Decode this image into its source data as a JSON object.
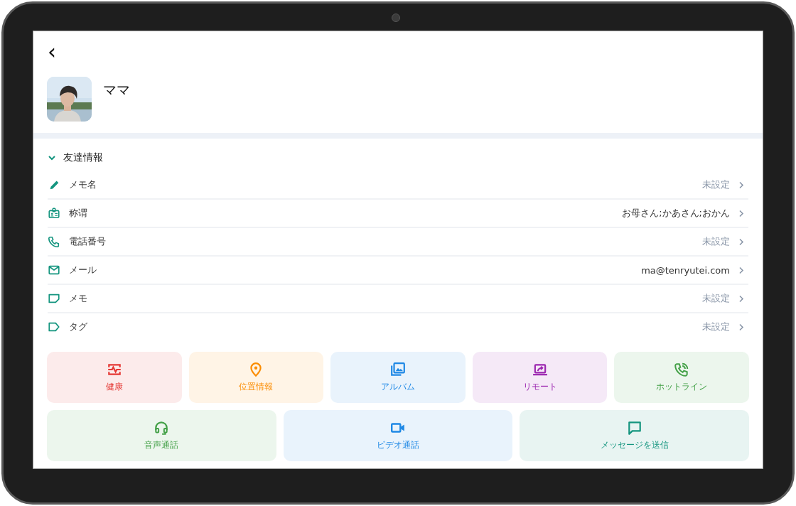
{
  "header": {
    "back": "‹",
    "name": "ママ"
  },
  "section": {
    "title": "友達情報",
    "expanded": true
  },
  "rows": [
    {
      "kind": "pencil",
      "label": "メモ名",
      "value": "未設定",
      "unset": true
    },
    {
      "kind": "badge",
      "label": "称谓",
      "value": "お母さん;かあさん;おかん",
      "unset": false
    },
    {
      "kind": "phone",
      "label": "電話番号",
      "value": "未設定",
      "unset": true
    },
    {
      "kind": "mail",
      "label": "メール",
      "value": "ma@tenryutei.com",
      "unset": false
    },
    {
      "kind": "note",
      "label": "メモ",
      "value": "未設定",
      "unset": true
    },
    {
      "kind": "tag",
      "label": "タグ",
      "value": "未設定",
      "unset": true
    }
  ],
  "actions": [
    [
      {
        "kind": "health",
        "label": "健康",
        "color": "#e53935"
      },
      {
        "kind": "location",
        "label": "位置情報",
        "color": "#fb8c00"
      },
      {
        "kind": "album",
        "label": "アルバム",
        "color": "#1e88e5"
      },
      {
        "kind": "remote",
        "label": "リモート",
        "color": "#9c27b0"
      },
      {
        "kind": "hotline",
        "label": "ホットライン",
        "color": "#43a047"
      }
    ],
    [
      {
        "kind": "voice",
        "label": "音声通話",
        "color": "#43a047"
      },
      {
        "kind": "video",
        "label": "ビデオ通話",
        "color": "#1e88e5"
      },
      {
        "kind": "message",
        "label": "メッセージを送信",
        "color": "#14957f"
      }
    ]
  ]
}
